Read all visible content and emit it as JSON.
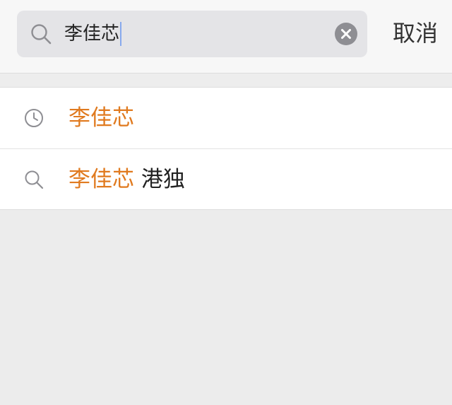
{
  "search": {
    "query": "李佳芯",
    "cancel_label": "取消"
  },
  "suggestions": [
    {
      "type": "history",
      "icon": "clock-icon",
      "highlight": "李佳芯",
      "rest": ""
    },
    {
      "type": "search",
      "icon": "search-icon",
      "highlight": "李佳芯",
      "rest": " 港独"
    }
  ],
  "colors": {
    "highlight": "#e07a1f",
    "header_bg": "#f7f7f7",
    "search_box_bg": "#e4e4e7",
    "page_bg": "#ececec"
  }
}
